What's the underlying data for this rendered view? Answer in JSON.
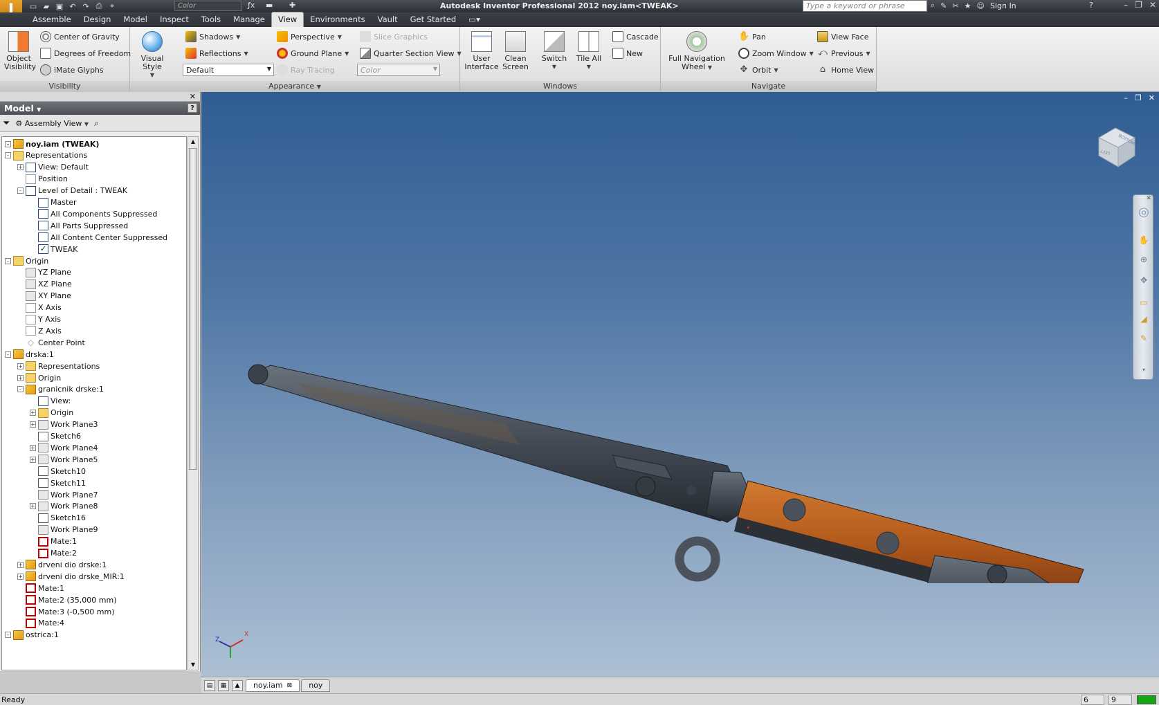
{
  "titlebar": {
    "app_title": "Autodesk Inventor Professional 2012    noy.iam<TWEAK>",
    "color_placeholder": "Color",
    "search_placeholder": "Type a keyword or phrase",
    "sign_in": "Sign In"
  },
  "tabs": [
    "Assemble",
    "Design",
    "Model",
    "Inspect",
    "Tools",
    "Manage",
    "View",
    "Environments",
    "Vault",
    "Get Started"
  ],
  "active_tab": "View",
  "ribbon": {
    "visibility": {
      "title": "Visibility",
      "object_visibility": "Object\nVisibility",
      "center_of_gravity": "Center of Gravity",
      "degrees_of_freedom": "Degrees of Freedom",
      "imate_glyphs": "iMate Glyphs"
    },
    "appearance": {
      "title": "Appearance",
      "visual_style": "Visual Style",
      "shadows": "Shadows",
      "reflections": "Reflections",
      "style_value": "Default",
      "perspective": "Perspective",
      "ground_plane": "Ground Plane",
      "ray_tracing": "Ray Tracing",
      "slice_graphics": "Slice Graphics",
      "quarter_section_view": "Quarter Section View",
      "color_value": "Color"
    },
    "windows": {
      "title": "Windows",
      "user_interface": "User\nInterface",
      "clean_screen": "Clean\nScreen",
      "switch": "Switch",
      "tile_all": "Tile All",
      "cascade": "Cascade",
      "new": "New"
    },
    "navigate": {
      "title": "Navigate",
      "full_navigation_wheel": "Full Navigation\nWheel",
      "pan": "Pan",
      "zoom_window": "Zoom Window",
      "orbit": "Orbit",
      "view_face": "View Face",
      "previous": "Previous",
      "home_view": "Home View"
    }
  },
  "browser": {
    "title": "Model",
    "view_mode": "Assembly View",
    "tree": [
      {
        "label": "noy.iam (TWEAK)",
        "depth": 0,
        "icon": "assembly-icon",
        "expander": "-",
        "bold": true
      },
      {
        "label": "Representations",
        "depth": 0,
        "icon": "representations-icon",
        "expander": "-"
      },
      {
        "label": "View: Default",
        "depth": 1,
        "icon": "view-rep-icon",
        "expander": "+"
      },
      {
        "label": "Position",
        "depth": 1,
        "icon": "position-icon",
        "expander": ""
      },
      {
        "label": "Level of Detail : TWEAK",
        "depth": 1,
        "icon": "lod-icon",
        "expander": "-"
      },
      {
        "label": "Master",
        "depth": 2,
        "icon": "lod-icon",
        "expander": ""
      },
      {
        "label": "All Components Suppressed",
        "depth": 2,
        "icon": "lod-icon",
        "expander": ""
      },
      {
        "label": "All Parts Suppressed",
        "depth": 2,
        "icon": "lod-icon",
        "expander": ""
      },
      {
        "label": "All Content Center Suppressed",
        "depth": 2,
        "icon": "lod-icon",
        "expander": ""
      },
      {
        "label": "TWEAK",
        "depth": 2,
        "icon": "lod-check-icon",
        "expander": "",
        "checked": true
      },
      {
        "label": "Origin",
        "depth": 0,
        "icon": "folder-open-icon",
        "expander": "-"
      },
      {
        "label": "YZ Plane",
        "depth": 1,
        "icon": "plane-icon",
        "expander": ""
      },
      {
        "label": "XZ Plane",
        "depth": 1,
        "icon": "plane-icon",
        "expander": ""
      },
      {
        "label": "XY Plane",
        "depth": 1,
        "icon": "plane-icon",
        "expander": ""
      },
      {
        "label": "X Axis",
        "depth": 1,
        "icon": "axis-icon",
        "expander": ""
      },
      {
        "label": "Y Axis",
        "depth": 1,
        "icon": "axis-icon",
        "expander": ""
      },
      {
        "label": "Z Axis",
        "depth": 1,
        "icon": "axis-icon",
        "expander": ""
      },
      {
        "label": "Center Point",
        "depth": 1,
        "icon": "point-icon",
        "expander": ""
      },
      {
        "label": "drska:1",
        "depth": 0,
        "icon": "subassembly-icon",
        "expander": "-"
      },
      {
        "label": "Representations",
        "depth": 1,
        "icon": "representations-icon",
        "expander": "+"
      },
      {
        "label": "Origin",
        "depth": 1,
        "icon": "folder-icon",
        "expander": "+"
      },
      {
        "label": "granicnik drske:1",
        "depth": 1,
        "icon": "part-icon",
        "expander": "-"
      },
      {
        "label": "View:",
        "depth": 2,
        "icon": "view-rep-icon",
        "expander": ""
      },
      {
        "label": "Origin",
        "depth": 2,
        "icon": "folder-icon",
        "expander": "+"
      },
      {
        "label": "Work Plane3",
        "depth": 2,
        "icon": "plane-icon",
        "expander": "+"
      },
      {
        "label": "Sketch6",
        "depth": 2,
        "icon": "sketch-icon",
        "expander": ""
      },
      {
        "label": "Work Plane4",
        "depth": 2,
        "icon": "plane-icon",
        "expander": "+"
      },
      {
        "label": "Work Plane5",
        "depth": 2,
        "icon": "plane-icon",
        "expander": "+"
      },
      {
        "label": "Sketch10",
        "depth": 2,
        "icon": "sketch-icon",
        "expander": ""
      },
      {
        "label": "Sketch11",
        "depth": 2,
        "icon": "sketch-icon",
        "expander": ""
      },
      {
        "label": "Work Plane7",
        "depth": 2,
        "icon": "plane-icon",
        "expander": ""
      },
      {
        "label": "Work Plane8",
        "depth": 2,
        "icon": "plane-icon",
        "expander": "+"
      },
      {
        "label": "Sketch16",
        "depth": 2,
        "icon": "sketch-icon",
        "expander": ""
      },
      {
        "label": "Work Plane9",
        "depth": 2,
        "icon": "plane-icon",
        "expander": ""
      },
      {
        "label": "Mate:1",
        "depth": 2,
        "icon": "mate-icon",
        "expander": ""
      },
      {
        "label": "Mate:2",
        "depth": 2,
        "icon": "mate-icon",
        "expander": ""
      },
      {
        "label": "drveni dio drske:1",
        "depth": 1,
        "icon": "part-icon",
        "expander": "+"
      },
      {
        "label": "drveni dio drske_MIR:1",
        "depth": 1,
        "icon": "part-icon",
        "expander": "+"
      },
      {
        "label": "Mate:1",
        "depth": 1,
        "icon": "mate-icon",
        "expander": ""
      },
      {
        "label": "Mate:2 (35,000 mm)",
        "depth": 1,
        "icon": "mate-icon",
        "expander": ""
      },
      {
        "label": "Mate:3 (-0,500 mm)",
        "depth": 1,
        "icon": "mate-icon",
        "expander": ""
      },
      {
        "label": "Mate:4",
        "depth": 1,
        "icon": "mate-icon",
        "expander": ""
      },
      {
        "label": "ostrica:1",
        "depth": 0,
        "icon": "part-icon",
        "expander": "-"
      }
    ]
  },
  "viewcube": {
    "left": "LEFT",
    "bottom": "BOTTOM"
  },
  "triad": {
    "x": "X",
    "z": "Z"
  },
  "doc_tabs": [
    {
      "label": "noy.iam",
      "active": true,
      "closable": true
    },
    {
      "label": "noy",
      "active": false,
      "closable": false
    }
  ],
  "status": {
    "text": "Ready",
    "num1": "6",
    "num2": "9"
  },
  "colors": {
    "viewport_top": "#2f5d93",
    "viewport_bottom": "#adc0d4",
    "handle_wood": "#b05a1e",
    "metal": "#3f4550",
    "status_ok": "#13a813"
  }
}
